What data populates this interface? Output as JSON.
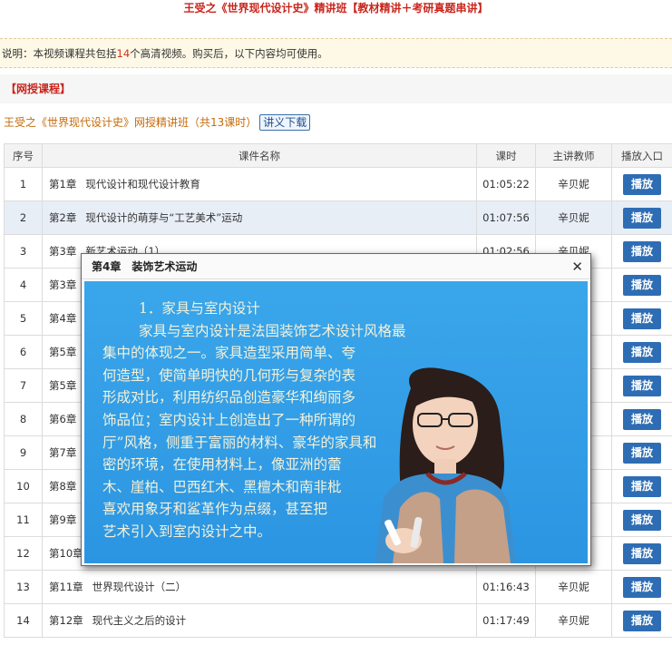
{
  "header": {
    "title": "王受之《世界现代设计史》精讲班【教材精讲＋考研真题串讲】"
  },
  "notice": {
    "prefix": "说明：本视频课程共包括",
    "count": "14",
    "suffix": "个高清视频。购买后，以下内容均可使用。"
  },
  "section": {
    "label": "【网授课程】"
  },
  "course": {
    "title": "王受之《世界现代设计史》网授精讲班（共13课时）",
    "download_label": "讲义下载"
  },
  "table": {
    "headers": [
      "序号",
      "课件名称",
      "课时",
      "主讲教师",
      "播放入口"
    ],
    "play_label": "播放",
    "rows": [
      {
        "idx": "1",
        "chapter": "第1章",
        "name": "现代设计和现代设计教育",
        "duration": "01:05:22",
        "teacher": "辛贝妮"
      },
      {
        "idx": "2",
        "chapter": "第2章",
        "name": "现代设计的萌芽与“工艺美术”运动",
        "duration": "01:07:56",
        "teacher": "辛贝妮"
      },
      {
        "idx": "3",
        "chapter": "第3章",
        "name": "新艺术运动（1）",
        "duration": "01:02:56",
        "teacher": "辛贝妮"
      },
      {
        "idx": "4",
        "chapter": "第3章",
        "name": "",
        "duration": "",
        "teacher": ""
      },
      {
        "idx": "5",
        "chapter": "第4章",
        "name": "",
        "duration": "",
        "teacher": ""
      },
      {
        "idx": "6",
        "chapter": "第5章",
        "name": "",
        "duration": "",
        "teacher": ""
      },
      {
        "idx": "7",
        "chapter": "第5章",
        "name": "",
        "duration": "",
        "teacher": ""
      },
      {
        "idx": "8",
        "chapter": "第6章",
        "name": "",
        "duration": "",
        "teacher": ""
      },
      {
        "idx": "9",
        "chapter": "第7章",
        "name": "",
        "duration": "",
        "teacher": ""
      },
      {
        "idx": "10",
        "chapter": "第8章",
        "name": "",
        "duration": "",
        "teacher": ""
      },
      {
        "idx": "11",
        "chapter": "第9章",
        "name": "",
        "duration": "",
        "teacher": ""
      },
      {
        "idx": "12",
        "chapter": "第10章",
        "name": "",
        "duration": "",
        "teacher": ""
      },
      {
        "idx": "13",
        "chapter": "第11章",
        "name": "世界现代设计（二）",
        "duration": "01:16:43",
        "teacher": "辛贝妮"
      },
      {
        "idx": "14",
        "chapter": "第12章",
        "name": "现代主义之后的设计",
        "duration": "01:17:49",
        "teacher": "辛贝妮"
      }
    ]
  },
  "popup": {
    "title": "第4章　装饰艺术运动",
    "board_lines": [
      "1．家具与室内设计",
      "家具与室内设计是法国装饰艺术设计风格最",
      "集中的体现之一。家具造型采用简单、夸",
      "何造型，使简单明快的几何形与复杂的表",
      "形成对比，利用纺织品创造豪华和绚丽多",
      "饰品位；室内设计上创造出了一种所谓的",
      "厅”风格，侧重于富丽的材料、豪华的家具和",
      "密的环境，在使用材料上，像亚洲的蕾",
      "木、崖柏、巴西红木、黑檀木和南非枇",
      "喜欢用象牙和鲨革作为点缀，甚至把",
      "艺术引入到室内设计之中。"
    ]
  }
}
